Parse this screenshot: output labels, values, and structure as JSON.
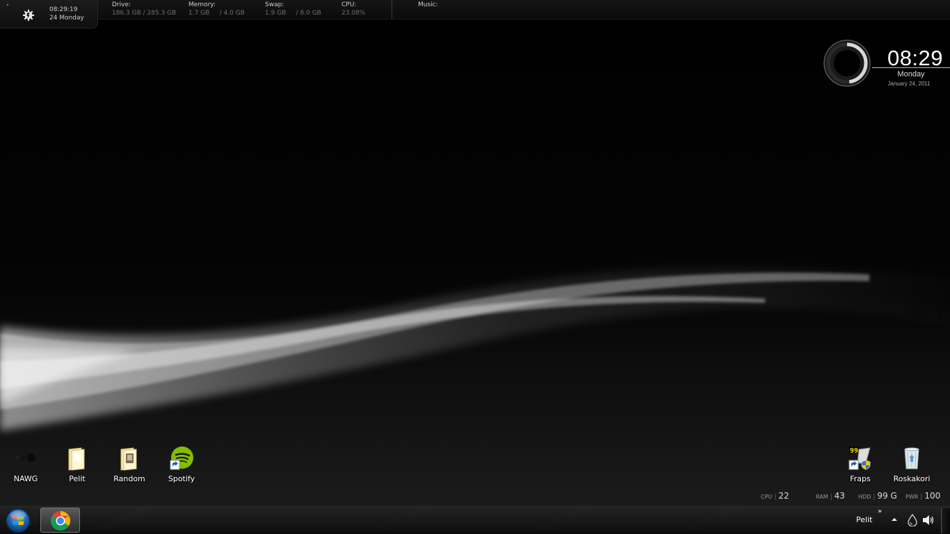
{
  "topbar": {
    "time": "08:29:19",
    "date": "24 Monday",
    "drive": {
      "label": "Drive:",
      "used": "186.3 GB",
      "total": "/ 285.3 GB"
    },
    "memory": {
      "label": "Memory:",
      "used": "1.7 GB",
      "total": "/ 4.0 GB"
    },
    "swap": {
      "label": "Swap:",
      "used": "1.9 GB",
      "total": "/ 8.0 GB"
    },
    "cpu": {
      "label": "CPU:",
      "value": "23.08%"
    },
    "music": {
      "label": "Music:"
    }
  },
  "clock_widget": {
    "time": "08:29",
    "day": "Monday",
    "date": "January 24, 2011",
    "ring_fraction": 0.48
  },
  "desktop_icons_left": [
    {
      "label": "NAWG",
      "icon": "nawg-dots-icon"
    },
    {
      "label": "Pelit",
      "icon": "folder-icon"
    },
    {
      "label": "Random",
      "icon": "folder-icon"
    },
    {
      "label": "Spotify",
      "icon": "spotify-icon"
    }
  ],
  "desktop_icons_right": [
    {
      "label": "Fraps",
      "icon": "fraps-icon"
    },
    {
      "label": "Roskakori",
      "icon": "recycle-bin-icon"
    }
  ],
  "bottom_stats": {
    "cpu": {
      "key": "CPU",
      "value": "22"
    },
    "ram": {
      "key": "RAM",
      "value": "43"
    },
    "hdd": {
      "key": "HDD",
      "value": "99 G"
    },
    "pwr": {
      "key": "PWR",
      "value": "100"
    }
  },
  "taskbar": {
    "start_icon": "windows-orb-icon",
    "pinned": [
      {
        "app": "Google Chrome",
        "icon": "chrome-icon"
      }
    ],
    "toolbar_label": "Pelit",
    "toolbar_chevron": "»",
    "tray": [
      "tray-show-hidden-icon",
      "network-icon",
      "volume-icon"
    ]
  },
  "colors": {
    "background": "#000000",
    "accent": "#ffffff",
    "spotify_green": "#84bd00",
    "fraps_yellow": "#f2e000"
  }
}
